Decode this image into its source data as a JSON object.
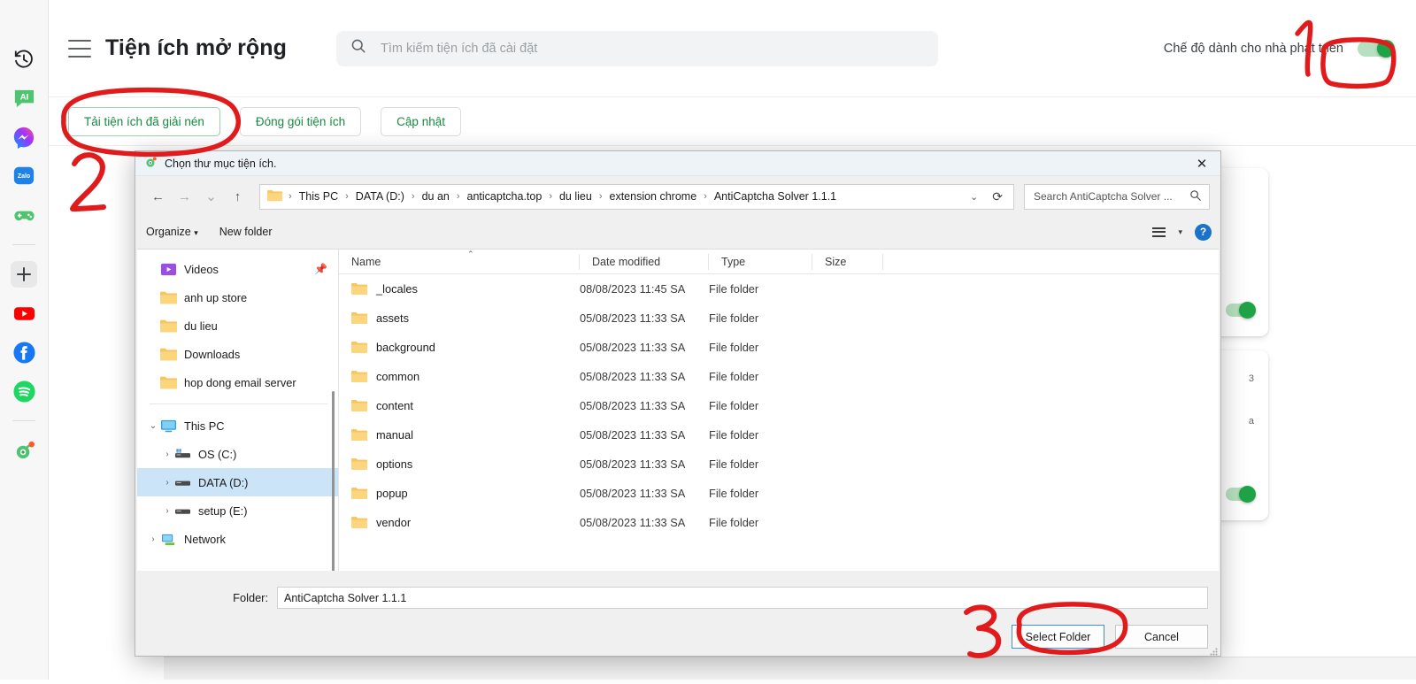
{
  "side_rail": {
    "items": [
      {
        "name": "history-icon",
        "label": "History"
      },
      {
        "name": "ai-icon",
        "label": "AI"
      },
      {
        "name": "messenger-icon",
        "label": "Messenger"
      },
      {
        "name": "zalo-icon",
        "label": "Zalo"
      },
      {
        "name": "games-icon",
        "label": "Games"
      },
      {
        "name": "add-icon",
        "label": "Add"
      },
      {
        "name": "youtube-icon",
        "label": "YouTube"
      },
      {
        "name": "facebook-icon",
        "label": "Facebook"
      },
      {
        "name": "spotify-icon",
        "label": "Spotify"
      },
      {
        "name": "extension-icon",
        "label": "Extension"
      }
    ]
  },
  "extensions_page": {
    "title": "Tiện ích mở rộng",
    "search_placeholder": "Tìm kiếm tiện ích đã cài đặt",
    "dev_mode_label": "Chế độ dành cho nhà phát triển",
    "dev_mode_on": true,
    "toolbar": {
      "load_unpacked": "Tải tiện ích đã giải nén",
      "pack_extension": "Đóng gói tiện ích",
      "update": "Cập nhật"
    }
  },
  "dialog": {
    "title": "Chọn thư mục tiện ích.",
    "close_label": "✕",
    "breadcrumbs": [
      "This PC",
      "DATA (D:)",
      "du an",
      "anticaptcha.top",
      "du lieu",
      "extension chrome",
      "AntiCaptcha Solver 1.1.1"
    ],
    "search_placeholder": "Search AntiCaptcha Solver ...",
    "commands": {
      "organize": "Organize",
      "new_folder": "New folder"
    },
    "tree": {
      "quick_access": [
        {
          "label": "Videos",
          "icon": "videos-icon",
          "pinned": true
        },
        {
          "label": "anh up store",
          "icon": "folder-icon",
          "pinned": false
        },
        {
          "label": "du lieu",
          "icon": "folder-icon",
          "pinned": false
        },
        {
          "label": "Downloads",
          "icon": "folder-icon",
          "pinned": false
        },
        {
          "label": "hop dong email server",
          "icon": "folder-icon",
          "pinned": false
        }
      ],
      "this_pc": {
        "label": "This PC",
        "icon": "computer-icon",
        "expanded": true
      },
      "drives": [
        {
          "label": "OS (C:)",
          "icon": "os-drive-icon",
          "selected": false
        },
        {
          "label": "DATA (D:)",
          "icon": "drive-icon",
          "selected": true
        },
        {
          "label": "setup (E:)",
          "icon": "drive-icon",
          "selected": false
        }
      ],
      "network": {
        "label": "Network",
        "icon": "network-icon"
      }
    },
    "columns": [
      "Name",
      "Date modified",
      "Type",
      "Size"
    ],
    "files": [
      {
        "name": "_locales",
        "date": "08/08/2023 11:45 SA",
        "type": "File folder",
        "size": ""
      },
      {
        "name": "assets",
        "date": "05/08/2023 11:33 SA",
        "type": "File folder",
        "size": ""
      },
      {
        "name": "background",
        "date": "05/08/2023 11:33 SA",
        "type": "File folder",
        "size": ""
      },
      {
        "name": "common",
        "date": "05/08/2023 11:33 SA",
        "type": "File folder",
        "size": ""
      },
      {
        "name": "content",
        "date": "05/08/2023 11:33 SA",
        "type": "File folder",
        "size": ""
      },
      {
        "name": "manual",
        "date": "05/08/2023 11:33 SA",
        "type": "File folder",
        "size": ""
      },
      {
        "name": "options",
        "date": "05/08/2023 11:33 SA",
        "type": "File folder",
        "size": ""
      },
      {
        "name": "popup",
        "date": "05/08/2023 11:33 SA",
        "type": "File folder",
        "size": ""
      },
      {
        "name": "vendor",
        "date": "05/08/2023 11:33 SA",
        "type": "File folder",
        "size": ""
      }
    ],
    "footer": {
      "folder_label": "Folder:",
      "folder_value": "AntiCaptcha Solver 1.1.1",
      "select_button": "Select Folder",
      "cancel_button": "Cancel"
    }
  },
  "annotations": {
    "markers": [
      {
        "number": "1",
        "target": "dev-mode-toggle"
      },
      {
        "number": "2",
        "target": "load-unpacked-button"
      },
      {
        "number": "3",
        "target": "select-folder-button"
      }
    ],
    "color": "#e11b1b"
  }
}
